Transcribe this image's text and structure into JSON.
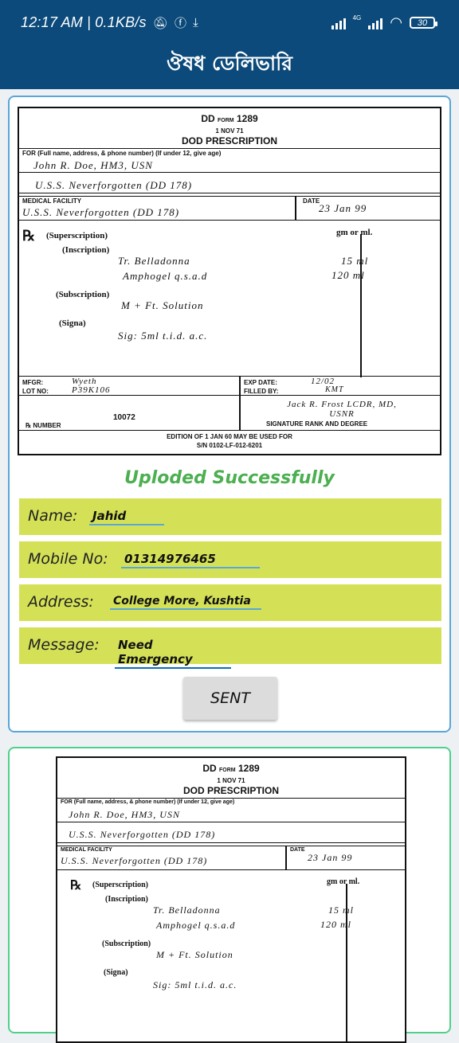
{
  "status": {
    "time_speed": "12:17 AM | 0.1KB/s",
    "network": "4G",
    "battery": "30"
  },
  "app": {
    "title": "ঔষধ ডেলিভারি"
  },
  "prescription": {
    "form_dd": "DD",
    "form_word": "FORM",
    "form_no": "1289",
    "form_date": "1 NOV 71",
    "form_title": "DOD PRESCRIPTION",
    "for_label": "FOR   (Full name, address, & phone number) (If under 12, give age)",
    "patient": "John R. Doe, HM3, USN",
    "ship": "U.S.S. Neverforgotten     (DD 178)",
    "facility_label": "MEDICAL FACILITY",
    "facility": "U.S.S. Neverforgotten  (DD 178)",
    "date_label": "DATE",
    "date": "23 Jan 99",
    "rx_symbol": "℞",
    "superscription": "(Superscription)",
    "units": "gm or ml.",
    "inscription": "(Inscription)",
    "drug1": "Tr. Belladonna",
    "dose1": "15  ml",
    "drug2": "Amphogel  q.s.a.d",
    "dose2": "120  ml",
    "subscription": "(Subscription)",
    "sub_text": "M + Ft. Solution",
    "signa": "(Signa)",
    "signa_text": "Sig: 5ml t.i.d. a.c.",
    "mfgr_label": "MFGR:",
    "mfgr": "Wyeth",
    "lot_label": "LOT NO:",
    "lot": "P39K106",
    "exp_label": "EXP DATE:",
    "exp": "12/02",
    "filled_label": "FILLED BY:",
    "filled": "KMT",
    "signature": "Jack R. Frost LCDR, MD, USNR",
    "sig_label": "SIGNATURE  RANK  AND  DEGREE",
    "rx_number_label": "℞  NUMBER",
    "rx_number": "10072",
    "edition": "EDITION OF 1 JAN 60 MAY BE USED   FOR",
    "sn": "S/N  0102-LF-012-6201"
  },
  "upload_status": "Uploded Successfully",
  "form": {
    "name_label": "Name:",
    "name_value": "Jahid",
    "mobile_label": "Mobile No:",
    "mobile_value": "01314976465",
    "address_label": "Address:",
    "address_value": "College More, Kushtia",
    "message_label": "Message:",
    "message_value": "Need Emergency"
  },
  "sent_label": "SENT"
}
